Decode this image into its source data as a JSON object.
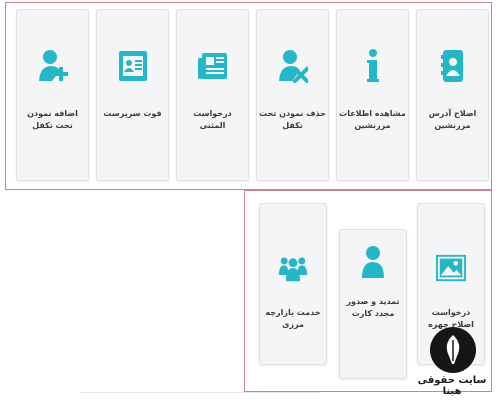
{
  "accent_color": "#25b6c8",
  "top_panel": {
    "tiles": [
      {
        "label": "اصلاح آدرس مرزنشین",
        "icon": "address-book-person-icon"
      },
      {
        "label": "مشاهده اطلاعات مرزنشین",
        "icon": "info-icon"
      },
      {
        "label": "حذف نمودن تحت تکفل",
        "icon": "remove-person-icon"
      },
      {
        "label": "درخواست المثنی",
        "icon": "newspaper-icon"
      },
      {
        "label": "فوت سرپرست",
        "icon": "id-card-icon"
      },
      {
        "label": "اضافه نمودن تحت تکفل",
        "icon": "add-person-icon"
      }
    ]
  },
  "bottom_panel": {
    "tiles": [
      {
        "label": "درخواست اصلاح چهره",
        "icon": "picture-icon"
      },
      {
        "label": "تمدید و صدور مجدد کارت",
        "icon": "person-icon"
      },
      {
        "label": "خدمت بازارچه مرزی",
        "icon": "group-icon"
      }
    ]
  },
  "brand": {
    "name": "سایت حقوقی هینا",
    "icon": "quill-logo-icon"
  }
}
